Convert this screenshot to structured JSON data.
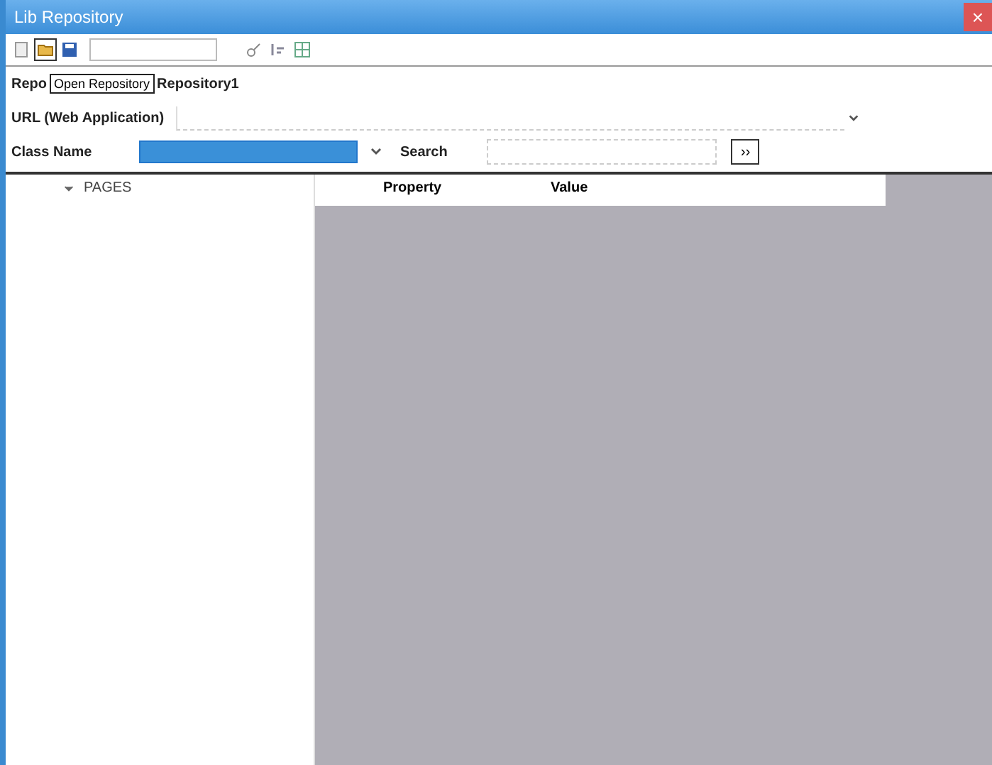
{
  "window": {
    "title": "Lib Repository",
    "close": "×"
  },
  "repo": {
    "label": "Repo",
    "tooltip": "Open Repository",
    "value": "Repository1"
  },
  "url": {
    "label": "URL (Web Application)"
  },
  "class_name": {
    "label": "Class Name",
    "selected": true
  },
  "search": {
    "label": "Search",
    "button": "››"
  },
  "tree": [
    {
      "label": "PAGES",
      "expanded": false
    }
  ],
  "table": {
    "columns": [
      "Property",
      "Value"
    ]
  }
}
